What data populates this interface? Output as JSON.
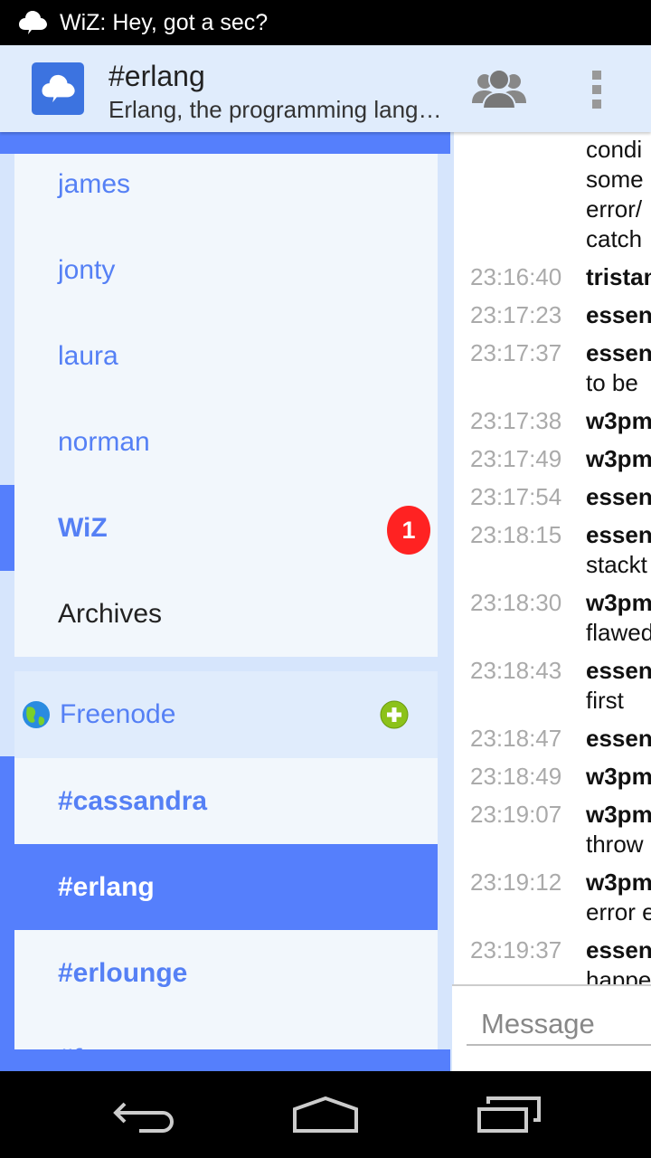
{
  "status_bar": {
    "notification": "WiZ: Hey, got a sec?",
    "icon": "cloud-chat-icon"
  },
  "app_bar": {
    "title": "#erlang",
    "subtitle": "Erlang, the programming language",
    "icons": [
      "app-logo",
      "users-icon",
      "overflow-menu-icon"
    ]
  },
  "sidebar": {
    "contacts": [
      {
        "label": "james"
      },
      {
        "label": "jonty"
      },
      {
        "label": "laura"
      },
      {
        "label": "norman"
      },
      {
        "label": "WiZ",
        "unread": "1",
        "bold": true
      },
      {
        "label": "Archives"
      }
    ],
    "network": {
      "label": "Freenode",
      "icon": "globe-icon",
      "add_icon": "add-channel-icon"
    },
    "channels": [
      {
        "label": "#cassandra"
      },
      {
        "label": "#erlang",
        "selected": true
      },
      {
        "label": "#erlounge"
      },
      {
        "label": "#f..."
      }
    ]
  },
  "chat": {
    "messages": [
      {
        "time": "",
        "nick": "",
        "lines": [
          "condi",
          "some",
          "error/",
          "catch"
        ]
      },
      {
        "time": "23:16:40",
        "nick": "tristan",
        "lines": []
      },
      {
        "time": "23:17:23",
        "nick": "essen",
        "lines": []
      },
      {
        "time": "23:17:37",
        "nick": "essen",
        "lines": [
          "to be"
        ]
      },
      {
        "time": "23:17:38",
        "nick": "w3pm",
        "lines": []
      },
      {
        "time": "23:17:49",
        "nick": "w3pm",
        "lines": []
      },
      {
        "time": "23:17:54",
        "nick": "essen",
        "lines": []
      },
      {
        "time": "23:18:15",
        "nick": "essen",
        "lines": [
          "stackt"
        ]
      },
      {
        "time": "23:18:30",
        "nick": "w3pm",
        "lines": [
          "flawed"
        ]
      },
      {
        "time": "23:18:43",
        "nick": "essen",
        "lines": [
          "first"
        ]
      },
      {
        "time": "23:18:47",
        "nick": "essen",
        "lines": []
      },
      {
        "time": "23:18:49",
        "nick": "w3pm",
        "lines": []
      },
      {
        "time": "23:19:07",
        "nick": "w3pm",
        "lines": [
          "throw"
        ]
      },
      {
        "time": "23:19:12",
        "nick": "w3pm",
        "lines": [
          "error e"
        ]
      },
      {
        "time": "23:19:37",
        "nick": "essen",
        "lines": [
          "happe"
        ]
      }
    ],
    "input_placeholder": "Message"
  },
  "colors": {
    "accent": "#557ffc",
    "badge": "#ff2222",
    "panel": "#f2f7fc",
    "header": "#e0ecfc"
  },
  "nav_bar": {
    "icons": [
      "back-icon",
      "home-icon",
      "recents-icon"
    ]
  }
}
